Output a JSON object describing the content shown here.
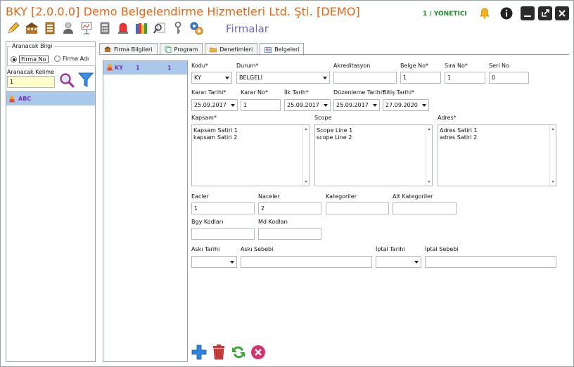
{
  "window": {
    "title": "BKY [2.0.0.0] Demo Belgelendirme Hizmetleri Ltd. Şti. [DEMO]",
    "user": "1 / YONETICI",
    "module": "Firmalar"
  },
  "toolbar": {
    "icons": [
      "pencil-icon",
      "building-icon",
      "document-stack-icon",
      "user-icon",
      "presentation-icon",
      "calculator-icon",
      "alarm-light-icon",
      "books-icon",
      "magnifier-document-icon",
      "key-icon",
      "gears-icon"
    ]
  },
  "search": {
    "group_label": "Aranacak Bilgi",
    "option_firma_no": "Firma No",
    "option_firma_adi": "Firma Adı",
    "keyword_label": "Aranacak Kelime",
    "keyword_value": "1"
  },
  "left_list": [
    {
      "name": "ABC"
    }
  ],
  "mid_list": [
    {
      "code": "KY",
      "col1": "1",
      "col2": "1"
    }
  ],
  "tabs": [
    "Firma Bilgileri",
    "Program",
    "Denetimleri",
    "Belgeleri"
  ],
  "form": {
    "kodu_label": "Kodu*",
    "kodu_value": "KY",
    "durum_label": "Durum*",
    "durum_value": "BELGELİ",
    "akreditasyon_label": "Akreditasyon",
    "akreditasyon_value": "",
    "belge_no_label": "Belge No*",
    "belge_no_value": "1",
    "sira_no_label": "Sıra No*",
    "sira_no_value": "1",
    "seri_no_label": "Seri No",
    "seri_no_value": "0",
    "karar_tarihi_label": "Karar Tarihi*",
    "karar_tarihi_value": "25.09.2017",
    "karar_no_label": "Karar No*",
    "karar_no_value": "1",
    "ilk_tarih_label": "İlk Tarih*",
    "ilk_tarih_value": "25.09.2017",
    "duzenleme_tarihi_label": "Düzenleme Tarihi*",
    "duzenleme_tarihi_value": "25.09.2017",
    "bitis_tarihi_label": "Bitiş Tarihi*",
    "bitis_tarihi_value": "27.09.2020",
    "kapsam_label": "Kapsam*",
    "kapsam_line1": "Kapsam Satiri 1",
    "kapsam_line2": "kapsam Satiri 2",
    "scope_label": "Scope",
    "scope_line1": "Scope Line 1",
    "scope_line2": "scope Line 2",
    "adres_label": "Adres*",
    "adres_line1": "Adres Satiri 1",
    "adres_line2": "adres Satiri 2",
    "eacler_label": "Eacler",
    "eacler_value": "1",
    "naceler_label": "Naceler",
    "naceler_value": "2",
    "kategoriler_label": "Kategoriler",
    "kategoriler_value": "",
    "alt_kategoriler_label": "Alt Kategoriler",
    "alt_kategoriler_value": "",
    "bgy_kodlari_label": "Bgy Kodları",
    "bgy_kodlari_value": "",
    "md_kodlari_label": "Md Kodları",
    "md_kodlari_value": "",
    "aski_tarihi_label": "Askı Tarihi",
    "aski_tarihi_value": "",
    "aski_sebebi_label": "Askı Sebebi",
    "aski_sebebi_value": "",
    "iptal_tarihi_label": "İptal Tarihi",
    "iptal_tarihi_value": "",
    "iptal_sebebi_label": "İptal Sebebi",
    "iptal_sebebi_value": ""
  },
  "actions": {
    "icons": [
      "add-icon",
      "delete-icon",
      "refresh-icon",
      "cancel-icon"
    ]
  },
  "colors": {
    "title": "#e0661a",
    "user": "#1f8a2c",
    "module": "#6b6bc9",
    "selected_row": "#aac8ea",
    "row_text": "#7b2fc0"
  }
}
